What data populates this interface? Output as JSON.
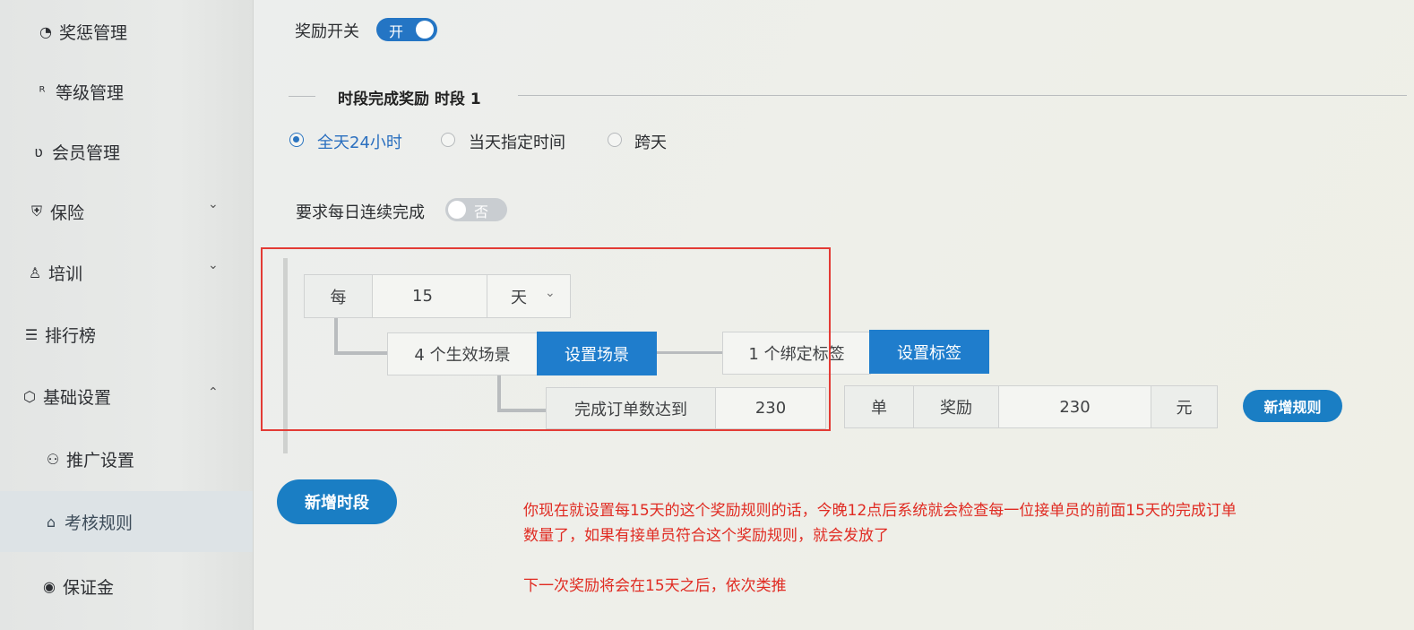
{
  "sidebar": {
    "items": [
      {
        "label": "奖惩管理",
        "icon": "timer-icon",
        "icon_glyph": "◔",
        "chevron": ""
      },
      {
        "label": "等级管理",
        "icon": "user-level-icon",
        "icon_glyph": "ᴿ",
        "chevron": ""
      },
      {
        "label": "会员管理",
        "icon": "member-badge-icon",
        "icon_glyph": "ʋ",
        "chevron": ""
      },
      {
        "label": "保险",
        "icon": "shield-icon",
        "icon_glyph": "⛨",
        "chevron": "⌄"
      },
      {
        "label": "培训",
        "icon": "training-icon",
        "icon_glyph": "♙",
        "chevron": "⌄"
      },
      {
        "label": "排行榜",
        "icon": "list-icon",
        "icon_glyph": "☰",
        "chevron": ""
      },
      {
        "label": "基础设置",
        "icon": "settings-hex-icon",
        "icon_glyph": "⬡",
        "chevron": "⌃"
      },
      {
        "label": "推广设置",
        "icon": "promote-user-icon",
        "icon_glyph": "⚇",
        "chevron": ""
      },
      {
        "label": "考核规则",
        "icon": "rule-house-icon",
        "icon_glyph": "⌂",
        "chevron": ""
      },
      {
        "label": "保证金",
        "icon": "deposit-icon",
        "icon_glyph": "◉",
        "chevron": ""
      }
    ]
  },
  "reward_switch": {
    "label": "奖励开关",
    "value": "开"
  },
  "section": {
    "title": "时段完成奖励 时段 1"
  },
  "time_options": {
    "selected": "全天24小时",
    "items": [
      "全天24小时",
      "当天指定时间",
      "跨天"
    ]
  },
  "consecutive": {
    "label": "要求每日连续完成",
    "value": "否"
  },
  "rule": {
    "every_label": "每",
    "period_value": "15",
    "period_unit": "天",
    "scene_count_text": "4 个生效场景",
    "set_scene_button": "设置场景",
    "tag_count_text": "1 个绑定标签",
    "set_tag_button": "设置标签",
    "complete_label": "完成订单数达到",
    "order_count": "230",
    "order_unit": "单",
    "reward_label": "奖励",
    "reward_amount": "230",
    "reward_unit": "元",
    "add_rule_button": "新增规则"
  },
  "add_period_button": "新增时段",
  "annotation": {
    "line1": "你现在就设置每15天的这个奖励规则的话，今晚12点后系统就会检查每一位接单员的前面15天的完成订单",
    "line2": "数量了，如果有接单员符合这个奖励规则，就会发放了",
    "line3": "下一次奖励将会在15天之后，依次类推"
  },
  "colors": {
    "accent": "#1f7dcc",
    "annotation": "#e02b22"
  }
}
